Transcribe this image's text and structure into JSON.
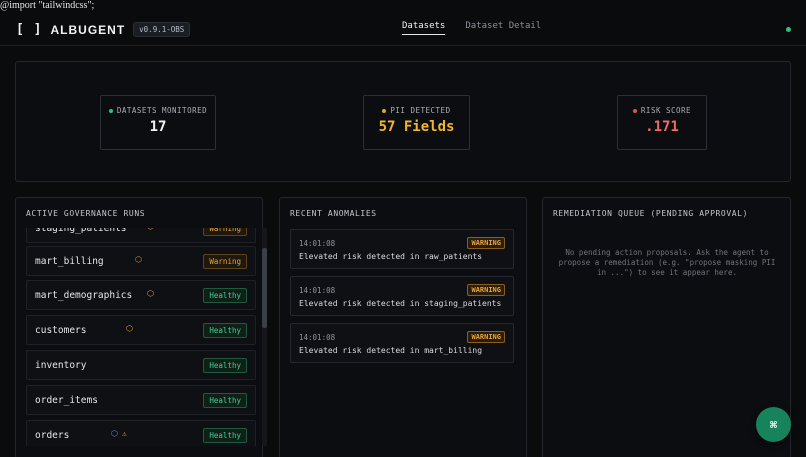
{
  "import_line": "@import \"tailwindcss\";",
  "brand": {
    "mark": "[ ]",
    "name": "ALBUGENT",
    "version": "v0.9.1-OBS"
  },
  "nav": {
    "tabs": [
      "Datasets",
      "Dataset Detail"
    ],
    "active": "Datasets"
  },
  "status_color": "#2ec27e",
  "stats": [
    {
      "label": "DATASETS MONITORED",
      "value": "17",
      "dot_color": "#2ec27e",
      "value_color": "#f2f2f2"
    },
    {
      "label": "PII DETECTED",
      "value": "57 Fields",
      "dot_color": "#e5a323",
      "value_color": "#f2b533"
    },
    {
      "label": "RISK SCORE",
      "value": ".171",
      "dot_color": "#e0524f",
      "value_color": "#ef6b65"
    }
  ],
  "runs": {
    "title": "ACTIVE GOVERNANCE RUNS",
    "rows": [
      {
        "name": "staging_patients",
        "icons": [
          "shield-icon"
        ],
        "status": "Warning"
      },
      {
        "name": "mart_billing",
        "icons": [
          "shield-icon"
        ],
        "status": "Warning"
      },
      {
        "name": "mart_demographics",
        "icons": [
          "shield-icon"
        ],
        "status": "Healthy"
      },
      {
        "name": "customers",
        "icons": [
          "shield-icon"
        ],
        "status": "Healthy"
      },
      {
        "name": "inventory",
        "icons": [],
        "status": "Healthy"
      },
      {
        "name": "order_items",
        "icons": [],
        "status": "Healthy"
      },
      {
        "name": "orders",
        "icons": [
          "shield-icon-blue",
          "warning-icon"
        ],
        "status": "Healthy"
      }
    ]
  },
  "anomalies": {
    "title": "RECENT ANOMALIES",
    "items": [
      {
        "time": "14:01:08",
        "badge": "WARNING",
        "text": "Elevated risk detected in raw_patients"
      },
      {
        "time": "14:01:08",
        "badge": "WARNING",
        "text": "Elevated risk detected in staging_patients"
      },
      {
        "time": "14:01:08",
        "badge": "WARNING",
        "text": "Elevated risk detected in mart_billing"
      }
    ]
  },
  "queue": {
    "title": "REMEDIATION QUEUE (PENDING APPROVAL)",
    "empty_text": "No pending action proposals. Ask the agent to propose a remediation (e.g. \"propose masking PII in ...\") to see it appear here."
  },
  "fab": {
    "icon": "command-icon",
    "glyph": "⌘"
  }
}
